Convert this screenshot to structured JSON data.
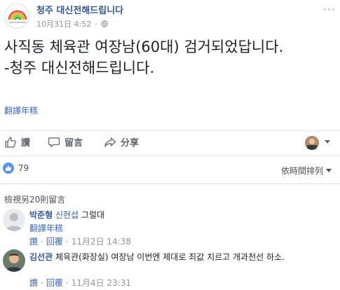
{
  "post": {
    "page_name": "청주 대신전해드립니다",
    "date": "10月31日 4:52",
    "privacy_sep": "·",
    "text_line1": "사직동 체육관 여장남(60대) 검거되었답니다.",
    "text_line2": "-청주 대신전해드립니다.",
    "translate_label": "翻譯年糕",
    "more_label": "···"
  },
  "actions": {
    "like_label": "讚",
    "comment_label": "留言",
    "share_label": "分享"
  },
  "reactions": {
    "count": "79",
    "sort_label": "依時間排列"
  },
  "comments": {
    "view_more_label": "檢視另20則留言",
    "items": [
      {
        "author": "박준형",
        "mention": "신현섭",
        "text": "그럴대",
        "translate_label": "翻譯年糕",
        "like_label": "讚",
        "reply_label": "回覆",
        "sep": "·",
        "time": "11月2日 14:38"
      },
      {
        "author": "김선관",
        "mention": "",
        "text": "체육관(화장실) 여장남 이번엔 제대로 죄값 치르고 개과천선 하소.",
        "translate_label": "",
        "like_label": "讚",
        "reply_label": "回覆",
        "sep": "·",
        "time": "11月4日 23:31"
      }
    ]
  },
  "colors": {
    "link": "#365899",
    "accent_blue": "#4267b2",
    "like_badge": "#5890ff",
    "muted": "#90949c"
  },
  "icons": {
    "page_avatar": "rainbow-logo-icon",
    "privacy": "globe-icon",
    "like": "thumbs-up-icon",
    "comment": "speech-bubble-icon",
    "share": "share-arrow-icon",
    "reaction": "like-badge-icon"
  }
}
